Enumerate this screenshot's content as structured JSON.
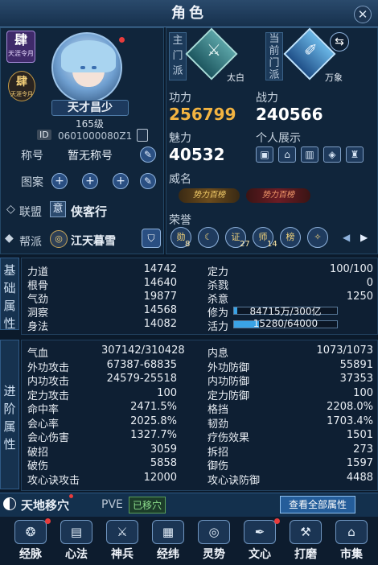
{
  "window": {
    "title": "角色",
    "close_icon": "close-icon"
  },
  "profile": {
    "badge_main": "肆",
    "badge_main_sub": "天涯令月",
    "badge_small": "肆",
    "badge_small_sub": "天涯令月",
    "name": "天才昌少",
    "level": "165级",
    "id_label": "ID",
    "id_value": "0601000080Z1",
    "title_label": "称号",
    "title_value": "暂无称号",
    "pattern_label": "图案",
    "alliance_label": "联盟",
    "alliance_badge": "意",
    "alliance_value": "侠客行",
    "guild_label": "帮派",
    "guild_value": "江天暮雪"
  },
  "sect": {
    "main_label": "主门派",
    "main_name": "太白",
    "current_label": "当前门派",
    "current_name": "万象"
  },
  "stats_top": {
    "kungfu_label": "功力",
    "kungfu_value": "256799",
    "power_label": "战力",
    "power_value": "240566",
    "charm_label": "魅力",
    "charm_value": "40532",
    "display_label": "个人展示",
    "fame_label": "威名",
    "fame_tag1": "势力百榜",
    "fame_tag2": "势力百榜",
    "honor_label": "荣誉",
    "honor_counts": [
      "8",
      "",
      "27",
      "14",
      "",
      ""
    ],
    "honor_marks": [
      "勋",
      "☾",
      "证",
      "师",
      "榜",
      "✧"
    ]
  },
  "basic": {
    "side_label": "基础属性",
    "left": [
      {
        "k": "力道",
        "v": "14742"
      },
      {
        "k": "根骨",
        "v": "14640"
      },
      {
        "k": "气劲",
        "v": "19877"
      },
      {
        "k": "洞察",
        "v": "14568"
      },
      {
        "k": "身法",
        "v": "14082"
      }
    ],
    "right": [
      {
        "k": "定力",
        "v": "100/100"
      },
      {
        "k": "杀戮",
        "v": "0"
      },
      {
        "k": "杀意",
        "v": "1250"
      },
      {
        "k": "修为",
        "v": "84715万/300亿",
        "fill": 0.028
      },
      {
        "k": "活力",
        "v": "15280/64000",
        "fill": 0.239
      }
    ]
  },
  "advanced": {
    "side_label": "进阶属性",
    "left": [
      {
        "k": "气血",
        "v": "307142/310428"
      },
      {
        "k": "外功攻击",
        "v": "67387-68835"
      },
      {
        "k": "内功攻击",
        "v": "24579-25518"
      },
      {
        "k": "定力攻击",
        "v": "100"
      },
      {
        "k": "命中率",
        "v": "2471.5%"
      },
      {
        "k": "会心率",
        "v": "2025.8%"
      },
      {
        "k": "会心伤害",
        "v": "1327.7%"
      },
      {
        "k": "破招",
        "v": "3059"
      },
      {
        "k": "破伤",
        "v": "5858"
      },
      {
        "k": "攻心诀攻击",
        "v": "12000"
      }
    ],
    "right": [
      {
        "k": "内息",
        "v": "1073/1073"
      },
      {
        "k": "外功防御",
        "v": "55891"
      },
      {
        "k": "内功防御",
        "v": "37353"
      },
      {
        "k": "定力防御",
        "v": "100"
      },
      {
        "k": "格挡",
        "v": "2208.0%"
      },
      {
        "k": "韧劲",
        "v": "1703.4%"
      },
      {
        "k": "疗伤效果",
        "v": "1501"
      },
      {
        "k": "拆招",
        "v": "273"
      },
      {
        "k": "御伤",
        "v": "1597"
      },
      {
        "k": "攻心诀防御",
        "v": "4488"
      }
    ]
  },
  "footer": {
    "skill_name": "天地移穴",
    "mode": "PVE",
    "status": "已移穴",
    "view_all": "查看全部属性"
  },
  "nav": [
    {
      "label": "经脉",
      "icon": "meridian-icon",
      "dot": true
    },
    {
      "label": "心法",
      "icon": "scroll-icon",
      "dot": false
    },
    {
      "label": "神兵",
      "icon": "sword-icon",
      "dot": false
    },
    {
      "label": "经纬",
      "icon": "grid-icon",
      "dot": false
    },
    {
      "label": "灵势",
      "icon": "swirl-icon",
      "dot": false
    },
    {
      "label": "文心",
      "icon": "brush-icon",
      "dot": true
    },
    {
      "label": "打磨",
      "icon": "hammer-icon",
      "dot": false
    },
    {
      "label": "市集",
      "icon": "market-icon",
      "dot": false
    }
  ]
}
